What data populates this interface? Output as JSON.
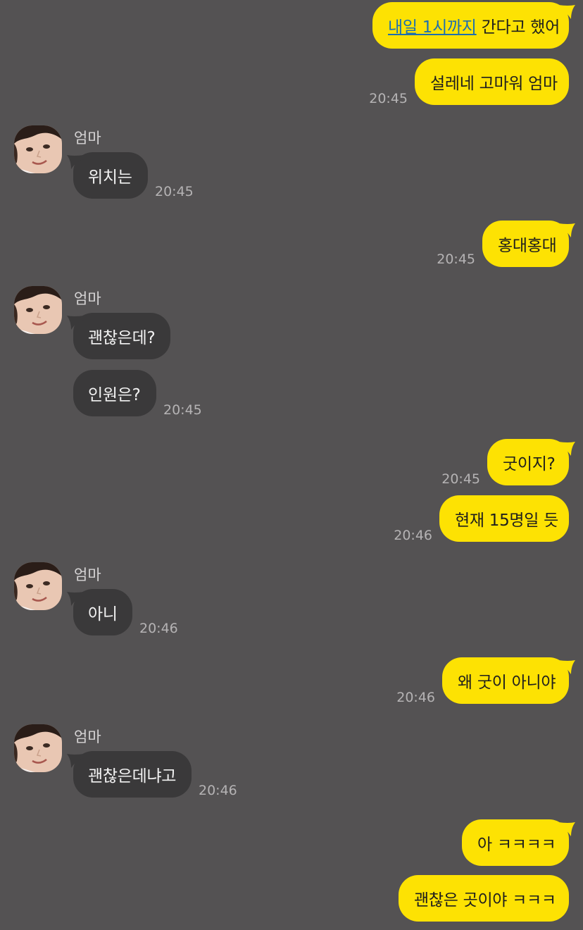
{
  "chat": {
    "contact_name": "엄마",
    "colors": {
      "background": "#545253",
      "my_bubble": "#fde203",
      "their_bubble": "#3a393a",
      "link": "#1d6fb0"
    },
    "messages": [
      {
        "from": "me",
        "link_text": "내일 1시까지",
        "text": " 간다고 했어"
      },
      {
        "from": "me",
        "text": "설레네 고마워 엄마",
        "time": "20:45"
      },
      {
        "from": "엄마",
        "text": "위치는",
        "time": "20:45"
      },
      {
        "from": "me",
        "text": "홍대홍대",
        "time": "20:45"
      },
      {
        "from": "엄마",
        "text": "괜찮은데?"
      },
      {
        "from": "엄마",
        "text": "인원은?",
        "time": "20:45"
      },
      {
        "from": "me",
        "text": "굿이지?",
        "time": "20:45"
      },
      {
        "from": "me",
        "text": "현재 15명일 듯",
        "time": "20:46"
      },
      {
        "from": "엄마",
        "text": "아니",
        "time": "20:46"
      },
      {
        "from": "me",
        "text": "왜 굿이 아니야",
        "time": "20:46"
      },
      {
        "from": "엄마",
        "text": "괜찮은데냐고",
        "time": "20:46"
      },
      {
        "from": "me",
        "text": "아 ㅋㅋㅋㅋ"
      },
      {
        "from": "me",
        "text": "괜찮은 곳이야 ㅋㅋㅋ"
      }
    ]
  }
}
